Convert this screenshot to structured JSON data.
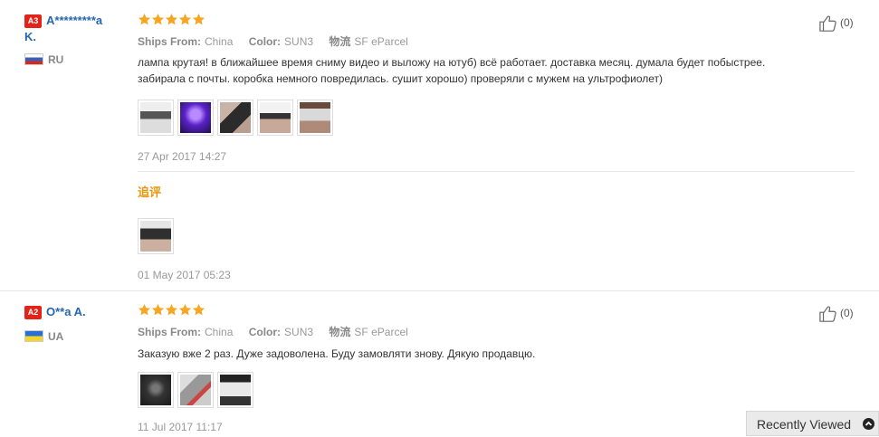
{
  "reviews": [
    {
      "level": "A3",
      "name_line1": "A*********a",
      "name_line2": "K.",
      "country_code": "RU",
      "rating": 5,
      "ships_from_label": "Ships From:",
      "ships_from": "China",
      "color_label": "Color:",
      "color": "SUN3",
      "logistics_label": "物流",
      "logistics": "SF eParcel",
      "text_line1": "лампа крутая! в ближайшее время сниму видео и выложу на ютуб) всё работает. доставка месяц. думала будет побыстрее.",
      "text_line2": "забирала с почты. коробка немного повредилась. сушит хорошо) проверяли с мужем на ультрофиолет)",
      "photo_count": 5,
      "date": "27 Apr 2017 14:27",
      "append_title": "追评",
      "append_photo_count": 1,
      "append_date": "01 May 2017 05:23",
      "helpful_count": "(0)"
    },
    {
      "level": "A2",
      "name_line1": "O**a A.",
      "country_code": "UA",
      "rating": 5,
      "ships_from_label": "Ships From:",
      "ships_from": "China",
      "color_label": "Color:",
      "color": "SUN3",
      "logistics_label": "物流",
      "logistics": "SF eParcel",
      "text_line1": "Заказую вже 2 раз. Дуже задоволена. Буду замовляти знову. Дякую продавцю.",
      "photo_count": 3,
      "date": "11 Jul 2017 11:17",
      "helpful_count": "(0)"
    }
  ],
  "recently_viewed": {
    "label": "Recently Viewed",
    "toggle_icon": "chevron-up-icon"
  },
  "colors": {
    "star": "#f5a623",
    "level_badge": "#e2231a",
    "username": "#2466b0",
    "append_title": "#e8960c"
  }
}
